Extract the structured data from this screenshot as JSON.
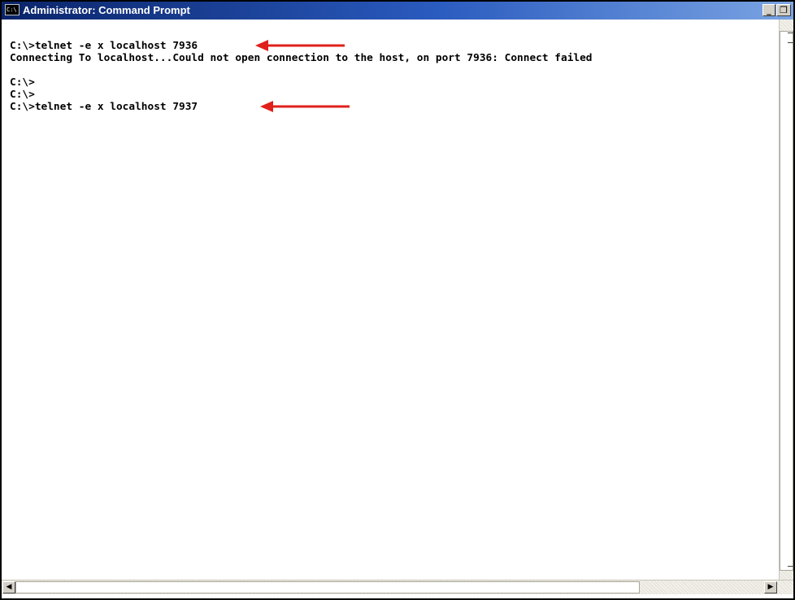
{
  "window": {
    "title": "Administrator: Command Prompt",
    "icon_label": "C:\\",
    "buttons": {
      "minimize": "_",
      "maximize": "❐"
    }
  },
  "console": {
    "lines": [
      "C:\\>telnet -e x localhost 7936",
      "Connecting To localhost...Could not open connection to the host, on port 7936: Connect failed",
      "",
      "C:\\>",
      "C:\\>",
      "C:\\>telnet -e x localhost 7937"
    ],
    "background": "#ffffff",
    "text_color": "#000000"
  },
  "annotations": {
    "arrow_color": "#e0201a",
    "arrows": [
      {
        "points_to_line": 0,
        "icon": "red-arrow-left-icon"
      },
      {
        "points_to_line": 5,
        "icon": "red-arrow-left-icon"
      }
    ]
  },
  "scrollbars": {
    "left_arrow": "◀",
    "right_arrow": "▶"
  },
  "colors": {
    "titlebar_start": "#0a246a",
    "titlebar_end": "#7aa4e3"
  }
}
